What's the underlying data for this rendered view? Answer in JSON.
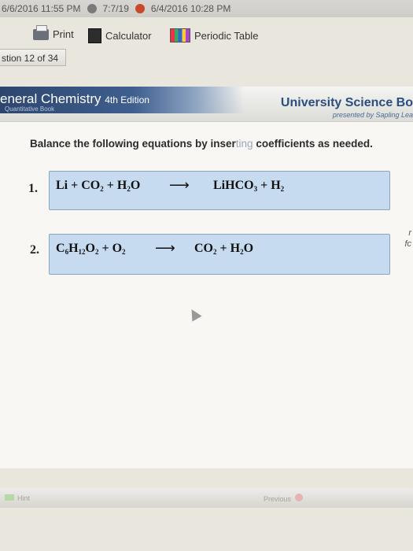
{
  "topstrip": {
    "left_text": "6/6/2016 11:55 PM",
    "mid_text": "7:7/19",
    "right_text": "6/4/2016 10:28 PM"
  },
  "toolbar": {
    "print": "Print",
    "calculator": "Calculator",
    "periodic_table": "Periodic Table"
  },
  "question_count": "stion 12 of 34",
  "header": {
    "course": "eneral Chemistry",
    "edition": "4th Edition",
    "sub": "Quantitative Book",
    "publisher": "University Science Bo",
    "presented": "presented by Sapling Lea"
  },
  "instructions": {
    "before": "Balance the following equations by inser",
    "faint": "ting",
    "after": " coefficients as needed."
  },
  "equations": [
    {
      "number": "1.",
      "reactants": [
        "Li",
        "CO",
        "H",
        "O"
      ],
      "products": [
        "LiHCO",
        "H"
      ]
    },
    {
      "number": "2.",
      "reactants": [
        "C",
        "H",
        "O",
        "O"
      ],
      "products": [
        "CO",
        "H",
        "O"
      ]
    }
  ],
  "footer": {
    "hint": "Hint",
    "previous": "Previous"
  },
  "edge_marks": [
    "r",
    "fc"
  ]
}
